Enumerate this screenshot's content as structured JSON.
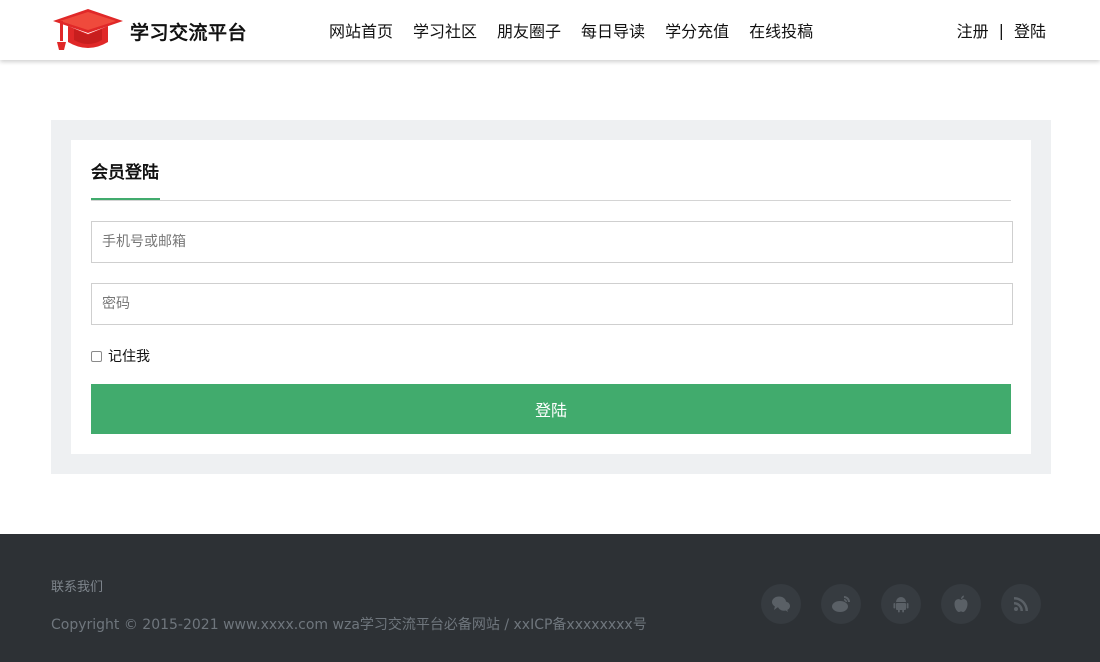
{
  "header": {
    "logo_text": "学习交流平台",
    "nav": [
      "网站首页",
      "学习社区",
      "朋友圈子",
      "每日导读",
      "学分充值",
      "在线投稿"
    ],
    "register_label": "注册",
    "separator": "|",
    "login_label": "登陆"
  },
  "login": {
    "title": "会员登陆",
    "account_placeholder": "手机号或邮箱",
    "password_placeholder": "密码",
    "remember_label": "记住我",
    "submit_label": "登陆"
  },
  "footer": {
    "contact_label": "联系我们",
    "copyright": "Copyright © 2015-2021 www.xxxx.com wza学习交流平台必备网站 / xxICP备xxxxxxxx号",
    "social_icons": [
      "wechat-icon",
      "weibo-icon",
      "android-icon",
      "apple-icon",
      "rss-icon"
    ]
  },
  "colors": {
    "accent": "#41ab6d",
    "logo_red": "#e02828",
    "footer_bg": "#2d3135",
    "panel_bg": "#eef0f2"
  }
}
